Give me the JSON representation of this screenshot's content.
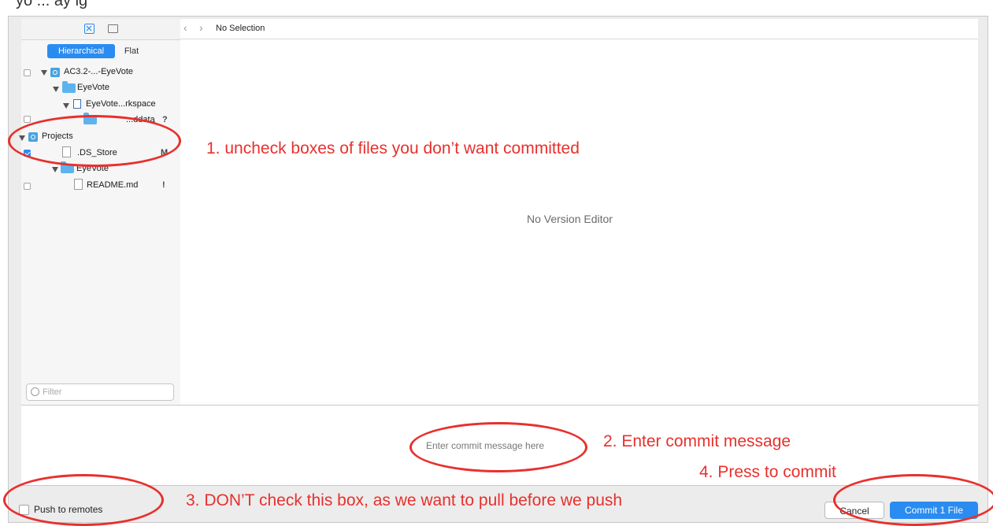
{
  "top_fragment": "yo ... ay ig",
  "sidebar": {
    "view_toggle": {
      "hierarchical": "Hierarchical",
      "flat": "Flat"
    },
    "tree": [
      {
        "label": "AC3.2-...-EyeVote",
        "status": ""
      },
      {
        "label": "EyeVote",
        "status": ""
      },
      {
        "label": "EyeVote...rkspace",
        "status": ""
      },
      {
        "label": "...ddata",
        "status": "?"
      },
      {
        "label": "Projects",
        "status": ""
      },
      {
        "label": ".DS_Store",
        "status": "M"
      },
      {
        "label": "EyeVote",
        "status": ""
      },
      {
        "label": "README.md",
        "status": "!"
      }
    ],
    "filter_placeholder": "Filter"
  },
  "pathbar": {
    "selection": "No Selection"
  },
  "main": {
    "empty_label": "No Version Editor"
  },
  "commit": {
    "placeholder": "Enter commit message here"
  },
  "footer": {
    "push_label": "Push to remotes",
    "cancel_label": "Cancel",
    "commit_label": "Commit 1 File"
  },
  "annotations": {
    "step1": "1. uncheck boxes of files you don’t want committed",
    "step2": "2. Enter commit message",
    "step3": "3. DON’T check this box, as we want to pull before we push",
    "step4": "4. Press to commit"
  },
  "colors": {
    "accent": "#2a8cf0",
    "annotation": "#e8302d"
  }
}
